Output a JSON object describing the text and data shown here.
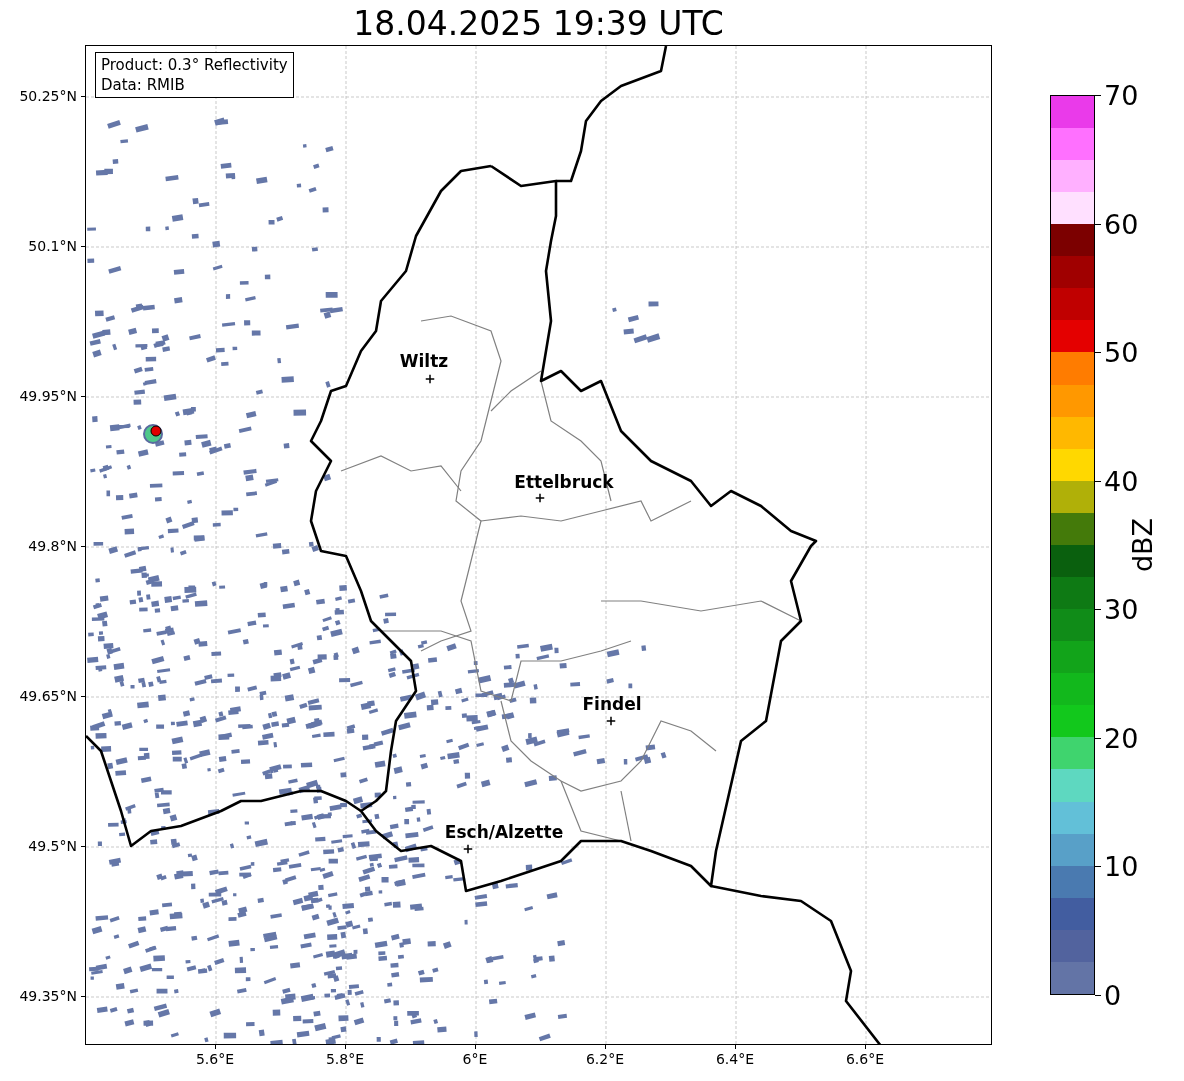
{
  "title": "18.04.2025 19:39 UTC",
  "info_box": {
    "lines": [
      "Product: 0.3° Reflectivity",
      "Data: RMIB"
    ]
  },
  "map": {
    "lat_ticks": [
      "50.25°N",
      "50.1°N",
      "49.95°N",
      "49.8°N",
      "49.65°N",
      "49.5°N",
      "49.35°N"
    ],
    "lon_ticks": [
      "5.6°E",
      "5.8°E",
      "6°E",
      "6.2°E",
      "6.4°E",
      "6.6°E"
    ],
    "cities": [
      {
        "name": "Wiltz"
      },
      {
        "name": "Ettelbruck"
      },
      {
        "name": "Findel"
      },
      {
        "name": "Esch/Alzette"
      }
    ]
  },
  "colorbar": {
    "label": "dBZ",
    "ticks": [
      "70",
      "60",
      "50",
      "40",
      "30",
      "20",
      "10",
      "0"
    ],
    "segments": [
      {
        "color": "#6374a6"
      },
      {
        "color": "#52639e"
      },
      {
        "color": "#425da0"
      },
      {
        "color": "#4a7ab0"
      },
      {
        "color": "#58a0c8"
      },
      {
        "color": "#62c0d8"
      },
      {
        "color": "#5ed8c0"
      },
      {
        "color": "#3fd46e"
      },
      {
        "color": "#12c81c"
      },
      {
        "color": "#12b81c"
      },
      {
        "color": "#12a41a"
      },
      {
        "color": "#108c18"
      },
      {
        "color": "#0e7a14"
      },
      {
        "color": "#0a600e"
      },
      {
        "color": "#447a0a"
      },
      {
        "color": "#b0b008"
      },
      {
        "color": "#ffd800"
      },
      {
        "color": "#ffb800"
      },
      {
        "color": "#ff9800"
      },
      {
        "color": "#ff7c00"
      },
      {
        "color": "#e40000"
      },
      {
        "color": "#c00000"
      },
      {
        "color": "#a00000"
      },
      {
        "color": "#7c0000"
      },
      {
        "color": "#ffe0ff"
      },
      {
        "color": "#ffb0ff"
      },
      {
        "color": "#ff70ff"
      },
      {
        "color": "#ea3aea"
      }
    ]
  }
}
